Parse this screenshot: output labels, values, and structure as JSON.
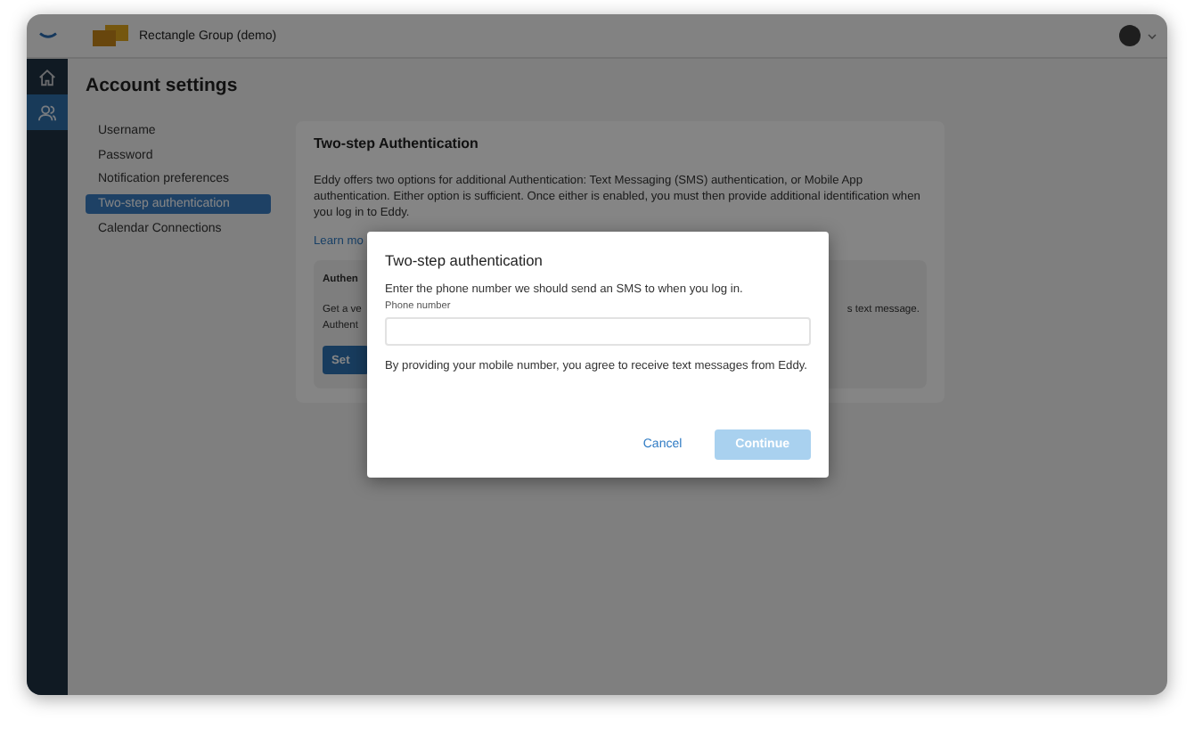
{
  "topbar": {
    "org_name": "Rectangle Group (demo)"
  },
  "sidebar": {
    "items": [
      {
        "kind": "home",
        "selected": false
      },
      {
        "kind": "people",
        "selected": true
      }
    ]
  },
  "page": {
    "title": "Account settings"
  },
  "settings_nav": {
    "items": [
      {
        "label": "Username",
        "selected": false
      },
      {
        "label": "Password",
        "selected": false
      },
      {
        "label": "Notification preferences",
        "selected": false
      },
      {
        "label": "Two-step authentication",
        "selected": true
      },
      {
        "label": "Calendar Connections",
        "selected": false
      }
    ]
  },
  "section": {
    "title": "Two-step Authentication",
    "description": "Eddy offers two options for additional Authentication: Text Messaging (SMS) authentication, or Mobile App authentication. Either option is sufficient. Once either is enabled, you must then provide additional identification when you log in to Eddy.",
    "link": "Learn mo",
    "option": {
      "title": "Authen",
      "line_1": "Get a ve",
      "line_2": "Authent",
      "line_end": "s text message.",
      "button": "Set"
    }
  },
  "dialog": {
    "title": "Two-step authentication",
    "instruction": "Enter the phone number we should send an SMS to when you log in.",
    "field": {
      "label": "Phone number"
    },
    "disclaimer": "By providing your mobile number, you agree to receive text messages from Eddy.",
    "buttons": [
      {
        "label": "Cancel",
        "kind": "link",
        "disabled": false
      },
      {
        "label": "Continue",
        "kind": "primary",
        "disabled": true
      }
    ]
  }
}
